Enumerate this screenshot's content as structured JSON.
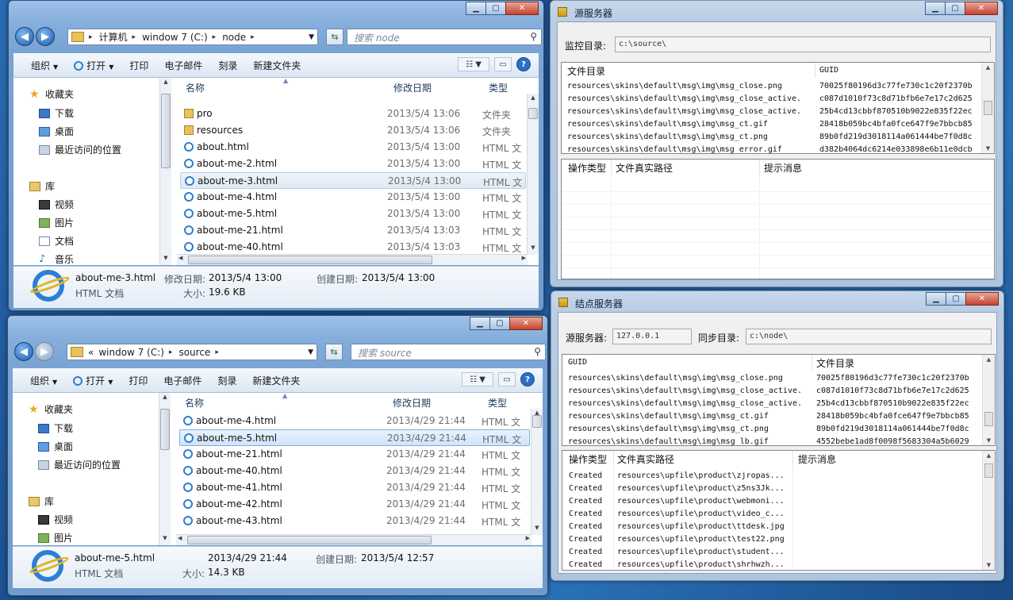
{
  "explorer_top": {
    "address": {
      "segments": [
        "计算机",
        "window 7 (C:)",
        "node"
      ]
    },
    "search_placeholder": "搜索 node",
    "toolbar": {
      "organize": "组织",
      "open": "打开",
      "print": "打印",
      "email": "电子邮件",
      "burn": "刻录",
      "new_folder": "新建文件夹"
    },
    "tree": {
      "favorites": "收藏夹",
      "downloads": "下载",
      "desktop": "桌面",
      "recent": "最近访问的位置",
      "libraries": "库",
      "videos": "视频",
      "pictures": "图片",
      "documents": "文档",
      "music": "音乐"
    },
    "columns": {
      "name": "名称",
      "modified": "修改日期",
      "type": "类型"
    },
    "files": [
      {
        "name": "pro",
        "date": "2013/5/4 13:06",
        "type": "文件夹",
        "kind": "folder"
      },
      {
        "name": "resources",
        "date": "2013/5/4 13:06",
        "type": "文件夹",
        "kind": "folder"
      },
      {
        "name": "about.html",
        "date": "2013/5/4 13:00",
        "type": "HTML 文",
        "kind": "html"
      },
      {
        "name": "about-me-2.html",
        "date": "2013/5/4 13:00",
        "type": "HTML 文",
        "kind": "html"
      },
      {
        "name": "about-me-3.html",
        "date": "2013/5/4 13:00",
        "type": "HTML 文",
        "kind": "html"
      },
      {
        "name": "about-me-4.html",
        "date": "2013/5/4 13:00",
        "type": "HTML 文",
        "kind": "html"
      },
      {
        "name": "about-me-5.html",
        "date": "2013/5/4 13:00",
        "type": "HTML 文",
        "kind": "html"
      },
      {
        "name": "about-me-21.html",
        "date": "2013/5/4 13:03",
        "type": "HTML 文",
        "kind": "html"
      },
      {
        "name": "about-me-40.html",
        "date": "2013/5/4 13:03",
        "type": "HTML 文",
        "kind": "html"
      }
    ],
    "details": {
      "name": "about-me-3.html",
      "modified_label": "修改日期:",
      "modified": "2013/5/4 13:00",
      "created_label": "创建日期:",
      "created": "2013/5/4 13:00",
      "type": "HTML 文档",
      "size_label": "大小:",
      "size": "19.6 KB"
    }
  },
  "explorer_bottom": {
    "address": {
      "prefix": "«",
      "segments": [
        "window 7 (C:)",
        "source"
      ]
    },
    "search_placeholder": "搜索 source",
    "toolbar": {
      "organize": "组织",
      "open": "打开",
      "print": "打印",
      "email": "电子邮件",
      "burn": "刻录",
      "new_folder": "新建文件夹"
    },
    "tree": {
      "favorites": "收藏夹",
      "downloads": "下载",
      "desktop": "桌面",
      "recent": "最近访问的位置",
      "libraries": "库",
      "videos": "视频",
      "pictures": "图片"
    },
    "columns": {
      "name": "名称",
      "modified": "修改日期",
      "type": "类型"
    },
    "files": [
      {
        "name": "about-me-4.html",
        "date": "2013/4/29 21:44",
        "type": "HTML 文"
      },
      {
        "name": "about-me-5.html",
        "date": "2013/4/29 21:44",
        "type": "HTML 文"
      },
      {
        "name": "about-me-21.html",
        "date": "2013/4/29 21:44",
        "type": "HTML 文"
      },
      {
        "name": "about-me-40.html",
        "date": "2013/4/29 21:44",
        "type": "HTML 文"
      },
      {
        "name": "about-me-41.html",
        "date": "2013/4/29 21:44",
        "type": "HTML 文"
      },
      {
        "name": "about-me-42.html",
        "date": "2013/4/29 21:44",
        "type": "HTML 文"
      },
      {
        "name": "about-me-43.html",
        "date": "2013/4/29 21:44",
        "type": "HTML 文"
      }
    ],
    "details": {
      "name": "about-me-5.html",
      "modified": "2013/4/29 21:44",
      "created_label": "创建日期:",
      "created": "2013/5/4 12:57",
      "type": "HTML 文档",
      "size_label": "大小:",
      "size": "14.3 KB"
    }
  },
  "source_server": {
    "title": "源服务器",
    "monitor_label": "监控目录:",
    "monitor_value": "c:\\source\\",
    "files_grid": {
      "headers": {
        "dir": "文件目录",
        "guid": "GUID"
      },
      "rows": [
        {
          "dir": "resources\\skins\\default\\msg\\img\\msg_close.png",
          "guid": "70025f80196d3c77fe730c1c20f2370b"
        },
        {
          "dir": "resources\\skins\\default\\msg\\img\\msg_close_active.",
          "guid": "c087d1010f73c8d71bfb6e7e17c2d625"
        },
        {
          "dir": "resources\\skins\\default\\msg\\img\\msg_close_active.",
          "guid": "25b4cd13cbbf870510b9022e835f22ec"
        },
        {
          "dir": "resources\\skins\\default\\msg\\img\\msg_ct.gif",
          "guid": "28418b059bc4bfa0fce647f9e7bbcb85"
        },
        {
          "dir": "resources\\skins\\default\\msg\\img\\msg_ct.png",
          "guid": "89b0fd219d3018114a061444be7f0d8c"
        },
        {
          "dir": "resources\\skins\\default\\msg\\img\\msg_error.gif",
          "guid": "d382b4064dc6214e033898e6b11e0dcb"
        }
      ]
    },
    "log_grid": {
      "headers": {
        "op": "操作类型",
        "path": "文件真实路径",
        "msg": "提示消息"
      }
    }
  },
  "node_server": {
    "title": "结点服务器",
    "source_label": "源服务器:",
    "source_value": "127.0.0.1",
    "sync_label": "同步目录:",
    "sync_value": "c:\\node\\",
    "files_grid": {
      "headers": {
        "guid": "GUID",
        "dir": "文件目录"
      },
      "rows": [
        {
          "a": "resources\\skins\\default\\msg\\img\\msg_close.png",
          "b": "70025f80196d3c77fe730c1c20f2370b"
        },
        {
          "a": "resources\\skins\\default\\msg\\img\\msg_close_active.",
          "b": "c087d1010f73c8d71bfb6e7e17c2d625"
        },
        {
          "a": "resources\\skins\\default\\msg\\img\\msg_close_active.",
          "b": "25b4cd13cbbf870510b9022e835f22ec"
        },
        {
          "a": "resources\\skins\\default\\msg\\img\\msg_ct.gif",
          "b": "28418b059bc4bfa0fce647f9e7bbcb85"
        },
        {
          "a": "resources\\skins\\default\\msg\\img\\msg_ct.png",
          "b": "89b0fd219d3018114a061444be7f0d8c"
        },
        {
          "a": "resources\\skins\\default\\msg\\img\\msg_lb.gif",
          "b": "4552bebe1ad8f0098f5683304a5b6029"
        }
      ]
    },
    "log_grid": {
      "headers": {
        "op": "操作类型",
        "path": "文件真实路径",
        "msg": "提示消息"
      },
      "rows": [
        {
          "op": "Created",
          "path": "resources\\upfile\\product\\zjropas..."
        },
        {
          "op": "Created",
          "path": "resources\\upfile\\product\\z5ns3Jk..."
        },
        {
          "op": "Created",
          "path": "resources\\upfile\\product\\webmoni..."
        },
        {
          "op": "Created",
          "path": "resources\\upfile\\product\\video_c..."
        },
        {
          "op": "Created",
          "path": "resources\\upfile\\product\\ttdesk.jpg"
        },
        {
          "op": "Created",
          "path": "resources\\upfile\\product\\test22.png"
        },
        {
          "op": "Created",
          "path": "resources\\upfile\\product\\student..."
        },
        {
          "op": "Created",
          "path": "resources\\upfile\\product\\shrhwzh..."
        }
      ]
    }
  }
}
